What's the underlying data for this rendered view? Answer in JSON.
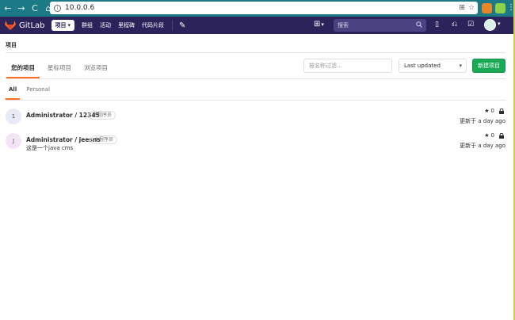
{
  "browser": {
    "url": "10.0.0.6",
    "nav": {
      "back": "←",
      "forward": "→",
      "reload": "C",
      "home": "⌂"
    },
    "actions": {
      "translate": "⊞",
      "star": "☆"
    },
    "menu": "⋮"
  },
  "header": {
    "brand": "GitLab",
    "nav_projects": "项目",
    "nav_groups": "群组",
    "nav_activity": "活动",
    "nav_milestones": "里程碑",
    "nav_snippets": "代码片段",
    "search_placeholder": "搜索",
    "icons": {
      "panel": "▯",
      "merge": "⎌",
      "todo": "☑"
    }
  },
  "page": {
    "breadcrumb": "项目",
    "tabs": [
      "您的项目",
      "星标项目",
      "浏览项目"
    ],
    "filter_placeholder": "按名称过滤...",
    "sort_value": "Last updated",
    "new_project": "新建项目",
    "subtabs": [
      "All",
      "Personal"
    ]
  },
  "projects": [
    {
      "initial": "1",
      "name": "Administrator / 12345",
      "badge": "主程序员",
      "description": "",
      "stars": "0",
      "updated": "更新于 a day ago"
    },
    {
      "initial": "J",
      "name": "Administrator / jeesns",
      "badge": "主程序员",
      "description": "这是一个java cms",
      "stars": "0",
      "updated": "更新于 a day ago"
    }
  ],
  "colors": {
    "header": "#2b2359",
    "accent": "#fc6d26",
    "new_button": "#1aaa55",
    "browser": "#1b7a86"
  }
}
